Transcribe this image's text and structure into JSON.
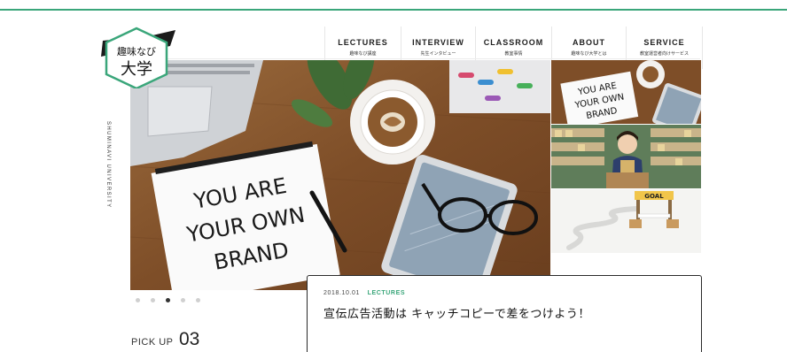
{
  "site": {
    "logo_text_top": "趣味なび",
    "logo_text_bottom": "大学",
    "brand_vertical": "SHUMINAVI UNIVERSITY",
    "accent_color": "#3aa67a"
  },
  "nav": {
    "items": [
      {
        "en": "LECTURES",
        "ja": "趣味なび講座"
      },
      {
        "en": "INTERVIEW",
        "ja": "先生インタビュー"
      },
      {
        "en": "CLASSROOM",
        "ja": "教室事情"
      },
      {
        "en": "ABOUT",
        "ja": "趣味なび大学とは"
      },
      {
        "en": "SERVICE",
        "ja": "教室運営者向けサービス"
      }
    ]
  },
  "hero": {
    "notebook_line1": "YOU ARE",
    "notebook_line2": "YOUR OWN",
    "notebook_line3": "BRAND"
  },
  "side_thumbs": {
    "thumb1_line1": "YOU ARE",
    "thumb1_line2": "YOUR OWN",
    "thumb1_line3": "BRAND",
    "thumb3_sign": "GOAL"
  },
  "slider": {
    "dot_count": 5,
    "active_index": 2
  },
  "pickup": {
    "label": "PICK UP",
    "number": "03"
  },
  "article": {
    "date": "2018.10.01",
    "category": "LECTURES",
    "title": "宣伝広告活動は キャッチコピーで差をつけよう！"
  }
}
